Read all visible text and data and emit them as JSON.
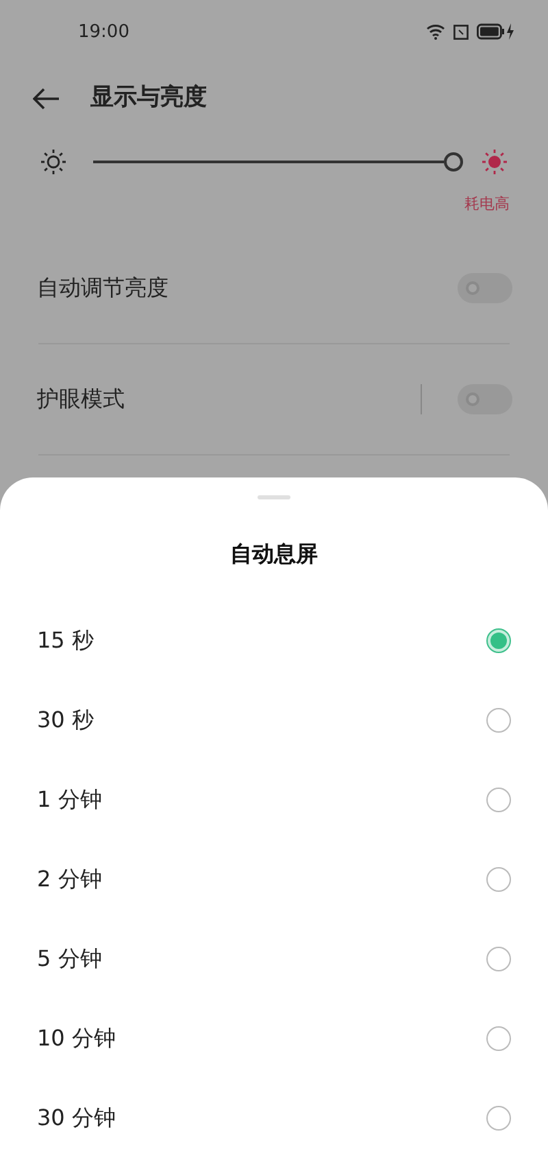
{
  "status_bar": {
    "time": "19:00"
  },
  "header": {
    "title": "显示与亮度"
  },
  "brightness": {
    "level": 1.0,
    "warning": "耗电高"
  },
  "settings": [
    {
      "label": "自动调节亮度",
      "on": false,
      "divider_before_toggle": false
    },
    {
      "label": "护眼模式",
      "on": false,
      "divider_before_toggle": true
    }
  ],
  "sheet": {
    "title": "自动息屏",
    "options": [
      {
        "label": "15 秒",
        "selected": true
      },
      {
        "label": "30 秒",
        "selected": false
      },
      {
        "label": "1 分钟",
        "selected": false
      },
      {
        "label": "2 分钟",
        "selected": false
      },
      {
        "label": "5 分钟",
        "selected": false
      },
      {
        "label": "10 分钟",
        "selected": false
      },
      {
        "label": "30 分钟",
        "selected": false
      }
    ]
  }
}
